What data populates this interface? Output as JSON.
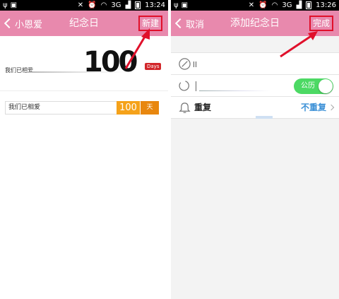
{
  "left": {
    "status": {
      "time": "13:24",
      "signal": "3G"
    },
    "navbar": {
      "back_label": "小恩爱",
      "title": "纪念日",
      "action_label": "新建"
    },
    "hero": {
      "number": "100",
      "badge": "Days",
      "label": "我们已相爱"
    },
    "list": [
      {
        "label": "我们已相爱",
        "number": "100",
        "unit": "天"
      }
    ]
  },
  "right": {
    "status": {
      "time": "13:26",
      "signal": "3G"
    },
    "navbar": {
      "back_label": "取消",
      "title": "添加纪念日",
      "action_label": "完成"
    },
    "rows": {
      "calendar_toggle_label": "公历",
      "repeat_label": "重复",
      "repeat_value": "不重复"
    }
  },
  "colors": {
    "nav_pink": "#e889ad",
    "highlight_red": "#e0102b",
    "accent_orange": "#f5a21a",
    "toggle_green": "#4cd964",
    "link_blue": "#3a8fd6"
  }
}
